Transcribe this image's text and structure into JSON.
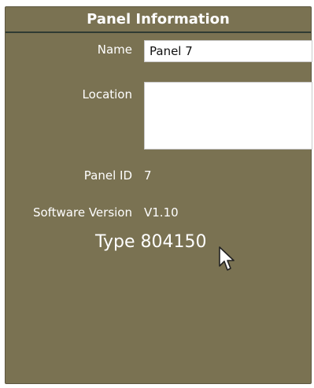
{
  "panel": {
    "title": "Panel Information",
    "name_label": "Name",
    "name_value": "Panel 7",
    "location_label": "Location",
    "location_value": "",
    "panel_id_label": "Panel ID",
    "panel_id_value": "7",
    "software_version_label": "Software Version",
    "software_version_value": "V1.10",
    "type_text": "Type 804150"
  },
  "colors": {
    "panel_background": "#7a7252",
    "title_rule": "#2f3b33",
    "text": "#ffffff",
    "input_background": "#ffffff"
  },
  "icons": {
    "cursor": "mouse-pointer-icon"
  }
}
